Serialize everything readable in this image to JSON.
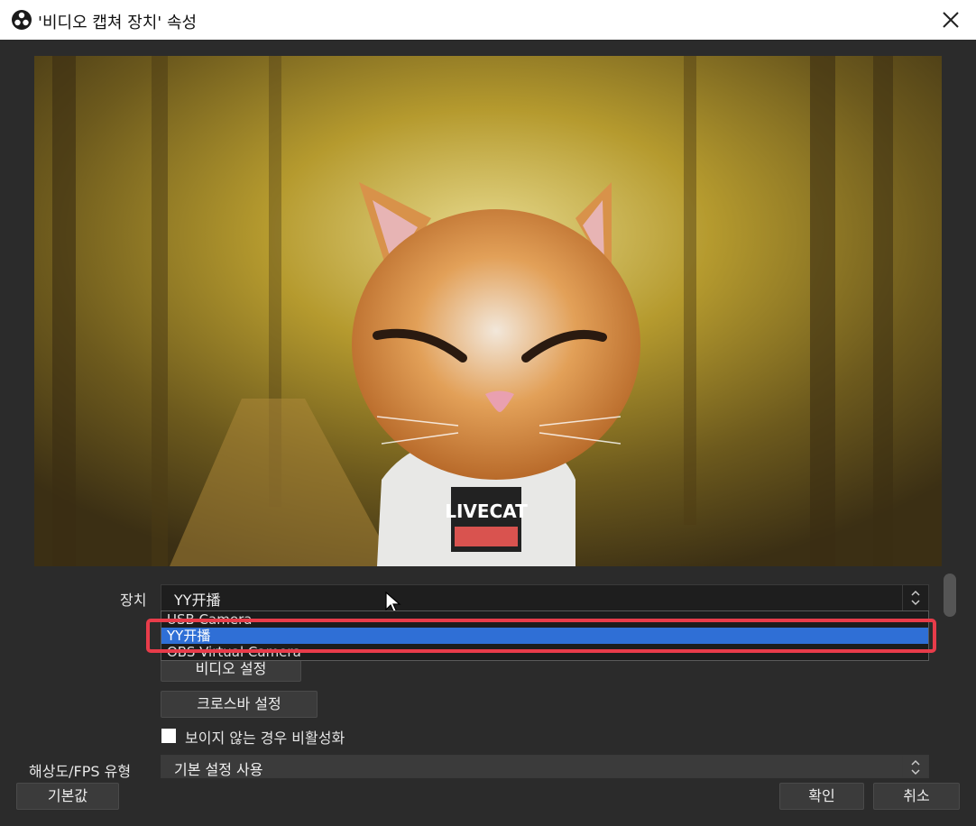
{
  "window": {
    "title": "'비디오 캡쳐 장치' 속성"
  },
  "form": {
    "device_label": "장치",
    "device_value": "YY开播",
    "device_options": [
      "USB Camera",
      "YY开播",
      "OBS Virtual Camera"
    ],
    "device_selected_index": 1,
    "video_settings_button": "비디오 설정",
    "crossbar_settings_button": "크로스바 설정",
    "deactivate_checkbox_label": "보이지 않는 경우 비활성화",
    "deactivate_checked": false,
    "resolution_label": "해상도/FPS 유형",
    "resolution_value": "기본 설정 사용"
  },
  "footer": {
    "defaults_button": "기본값",
    "ok_button": "확인",
    "cancel_button": "취소"
  },
  "preview": {
    "shirt_text": "LIVECAT"
  },
  "colors": {
    "selection": "#2f6fd6",
    "highlight_box": "#e83c4a",
    "background": "#2b2b2b"
  },
  "icons": [
    "obs-logo-icon",
    "close-icon",
    "combo-spin-icon",
    "mouse-cursor-icon"
  ]
}
